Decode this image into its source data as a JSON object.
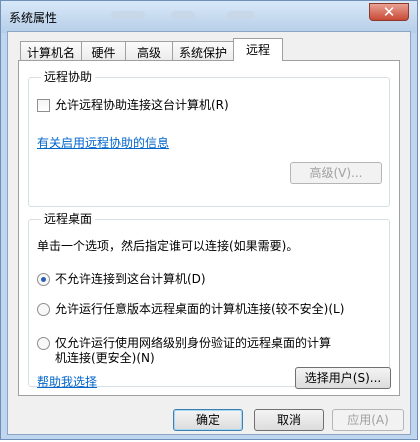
{
  "window": {
    "title": "系统属性",
    "close_glyph": "✕"
  },
  "tabs": [
    {
      "label": "计算机名"
    },
    {
      "label": "硬件"
    },
    {
      "label": "高级"
    },
    {
      "label": "系统保护"
    },
    {
      "label": "远程"
    }
  ],
  "remote_assist": {
    "group_title": "远程协助",
    "checkbox_label": "允许远程协助连接这台计算机(R)",
    "checked": false,
    "info_link": "有关启用远程协助的信息",
    "advanced_button": "高级(V)..."
  },
  "remote_desktop": {
    "group_title": "远程桌面",
    "instruction": "单击一个选项，然后指定谁可以连接(如果需要)。",
    "options": [
      {
        "label_line1": "不允许连接到这台计算机(D)",
        "label_line2": "",
        "selected": true
      },
      {
        "label_line1": "允许运行任意版本远程桌面的计算机连接(较不安全)(L)",
        "label_line2": "",
        "selected": false
      },
      {
        "label_line1": "仅允许运行使用网络级别身份验证的远程桌面的计算",
        "label_line2": "机连接(更安全)(N)",
        "selected": false
      }
    ],
    "help_link": "帮助我选择",
    "select_users_button": "选择用户(S)..."
  },
  "footer": {
    "ok": "确定",
    "cancel": "取消",
    "apply": "应用(A)"
  }
}
